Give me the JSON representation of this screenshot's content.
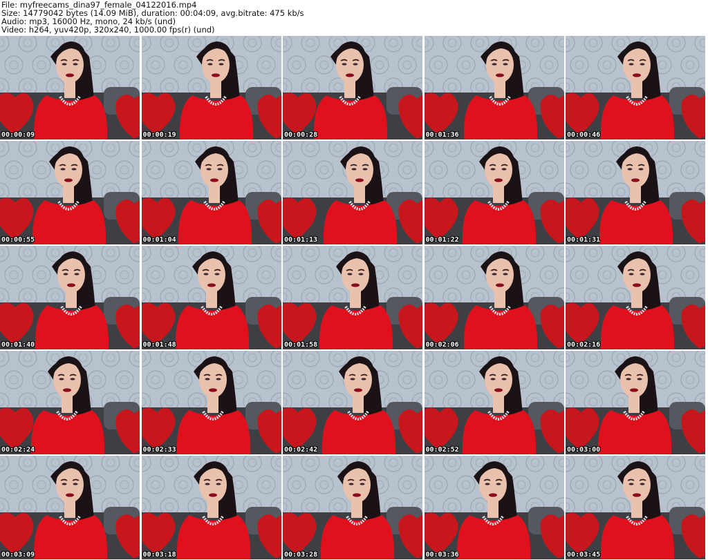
{
  "header": {
    "file_line": "File: myfreecams_dina97_female_04122016.mp4",
    "size_line": "Size: 14779042 bytes (14.09 MiB), duration: 00:04:09, avg.bitrate: 475 kb/s",
    "audio_line": "Audio: mp3, 16000 Hz, mono, 24 kb/s (und)",
    "video_line": "Video: h264, yuv420p, 320x240, 1000.00 fps(r) (und)"
  },
  "colors": {
    "wall": "#b8c2ce",
    "wall_dark": "#8e9aab",
    "sofa": "#3d3f45",
    "pillow": "#c8161d",
    "dress": "#e0111c",
    "hair": "#1a1214",
    "skin": "#e9c1ad",
    "lips": "#8a0c1e",
    "necklace": "#dfe3ea"
  },
  "thumbnails": [
    {
      "time": "00:00:09"
    },
    {
      "time": "00:00:19"
    },
    {
      "time": "00:00:28"
    },
    {
      "time": "00:01:36"
    },
    {
      "time": "00:00:46"
    },
    {
      "time": "00:00:55"
    },
    {
      "time": "00:01:04"
    },
    {
      "time": "00:01:13"
    },
    {
      "time": "00:01:22"
    },
    {
      "time": "00:01:31"
    },
    {
      "time": "00:01:40"
    },
    {
      "time": "00:01:48"
    },
    {
      "time": "00:01:58"
    },
    {
      "time": "00:02:06"
    },
    {
      "time": "00:02:16"
    },
    {
      "time": "00:02:24"
    },
    {
      "time": "00:02:33"
    },
    {
      "time": "00:02:42"
    },
    {
      "time": "00:02:52"
    },
    {
      "time": "00:03:00"
    },
    {
      "time": "00:03:09"
    },
    {
      "time": "00:03:18"
    },
    {
      "time": "00:03:28"
    },
    {
      "time": "00:03:36"
    },
    {
      "time": "00:03:45"
    }
  ]
}
